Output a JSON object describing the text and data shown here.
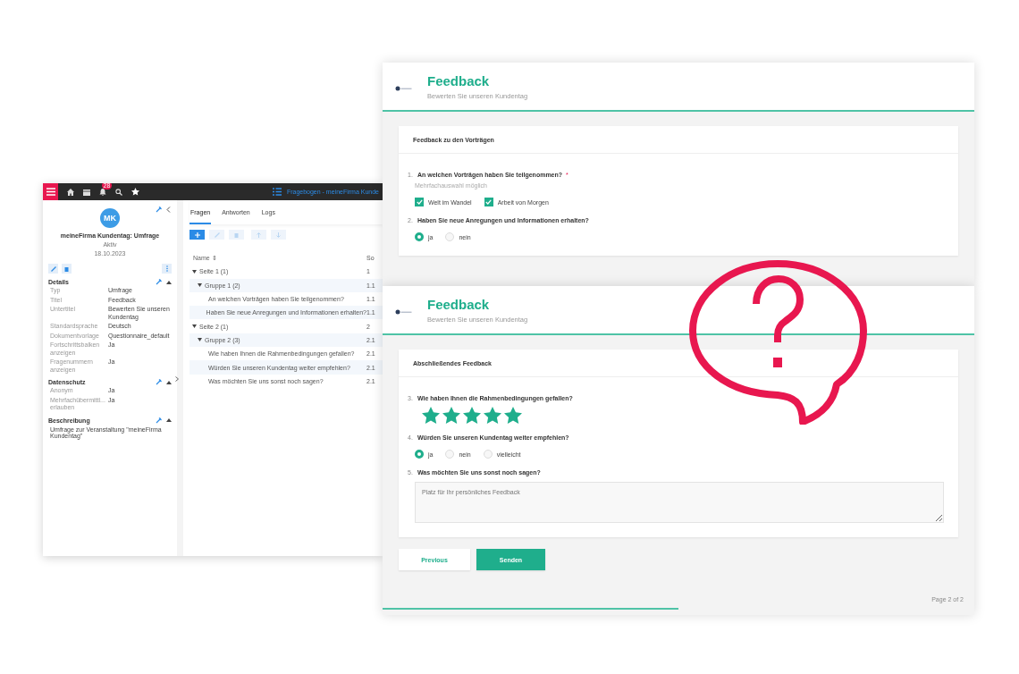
{
  "admin": {
    "topbar": {
      "notification_count": "28",
      "title": "Fragebogen - meineFirma Kunde"
    },
    "profile": {
      "initials": "MK",
      "name": "meineFirma Kundentag: Umfrage",
      "status": "Aktiv",
      "date": "18.10.2023"
    },
    "sections": [
      {
        "title": "Details",
        "rows": [
          {
            "label": "Typ",
            "value": "Umfrage"
          },
          {
            "label": "Titel",
            "value": "Feedback"
          },
          {
            "label": "Untertitel",
            "value": "Bewerten Sie unseren Kundentag"
          },
          {
            "label": "Standardsprache",
            "value": "Deutsch"
          },
          {
            "label": "Dokumentvorlage",
            "value": "Questionnaire_default"
          },
          {
            "label": "Fortschrittsbalken anzeigen",
            "value": "Ja"
          },
          {
            "label": "Fragenummern anzeigen",
            "value": "Ja"
          }
        ]
      },
      {
        "title": "Datenschutz",
        "rows": [
          {
            "label": "Anonym",
            "value": "Ja"
          },
          {
            "label": "Mehrfachübermittl... erlauben",
            "value": "Ja"
          }
        ]
      },
      {
        "title": "Beschreibung",
        "text": "Umfrage zur Veranstaltung \"meineFirma Kundentag\""
      }
    ],
    "tabs": [
      {
        "label": "Fragen",
        "selected": true
      },
      {
        "label": "Antworten",
        "selected": false
      },
      {
        "label": "Logs",
        "selected": false
      }
    ],
    "table": {
      "columns": [
        "Name ⇕",
        "So"
      ],
      "rows": [
        {
          "name": "Seite 1 (1)",
          "col_2": "1",
          "expanded": true,
          "children": [
            {
              "name": "Gruppe 1 (2)",
              "col_2": "1.1",
              "expanded": true,
              "children": [
                {
                  "name": "An welchen Vorträgen haben Sie teilgenommen?",
                  "col_2": "1.1"
                },
                {
                  "name": "Haben Sie neue Anregungen und Informationen erhalten?",
                  "col_2": "1.1"
                }
              ]
            }
          ]
        },
        {
          "name": "Seite 2 (1)",
          "col_2": "2",
          "expanded": true,
          "children": [
            {
              "name": "Gruppe 2 (3)",
              "col_2": "2.1",
              "expanded": true,
              "children": [
                {
                  "name": "Wie haben Ihnen die Rahmenbedingungen gefallen?",
                  "col_2": "2.1"
                },
                {
                  "name": "Würden Sie unseren Kundentag weiter empfehlen?",
                  "col_2": "2.1"
                },
                {
                  "name": "Was möchten Sie uns sonst noch sagen?",
                  "col_2": "2.1"
                }
              ]
            }
          ]
        }
      ]
    }
  },
  "forms": [
    {
      "title": "Feedback",
      "subtitle": "Bewerten Sie unseren Kundentag",
      "section_title": "Feedback zu den Vorträgen",
      "questions": [
        {
          "number": "1.",
          "kind": "checkbox",
          "text": "An welchen Vorträgen haben Sie teilgenommen?",
          "required_mark": "*",
          "hint": "Mehrfachauswahl möglich",
          "options": [
            {
              "label": "Welt im Wandel",
              "checked": true
            },
            {
              "label": "Arbeit von Morgen",
              "checked": true
            }
          ]
        },
        {
          "number": "2.",
          "kind": "radio",
          "text": "Haben Sie neue Anregungen und Informationen erhalten?",
          "options": [
            {
              "label": "ja",
              "selected": true
            },
            {
              "label": "nein",
              "selected": false
            }
          ]
        }
      ]
    },
    {
      "title": "Feedback",
      "subtitle": "Bewerten Sie unseren Kundentag",
      "section_title": "Abschließendes Feedback",
      "questions": [
        {
          "number": "3.",
          "kind": "stars",
          "text": "Wie haben Ihnen die Rahmenbedingungen gefallen?",
          "stars": 5
        },
        {
          "number": "4.",
          "kind": "radio",
          "text": "Würden Sie unseren Kundentag weiter empfehlen?",
          "options": [
            {
              "label": "ja",
              "selected": true
            },
            {
              "label": "nein",
              "selected": false
            },
            {
              "label": "vielleicht",
              "selected": false
            }
          ]
        },
        {
          "number": "5.",
          "kind": "textarea",
          "text": "Was möchten Sie uns sonst noch sagen?",
          "placeholder": "Platz für Ihr persönliches Feedback"
        }
      ],
      "buttons": [
        "Previous",
        "Senden"
      ],
      "page_label": "Page 2 of 2",
      "progress": {
        "level": 0.5
      }
    }
  ]
}
